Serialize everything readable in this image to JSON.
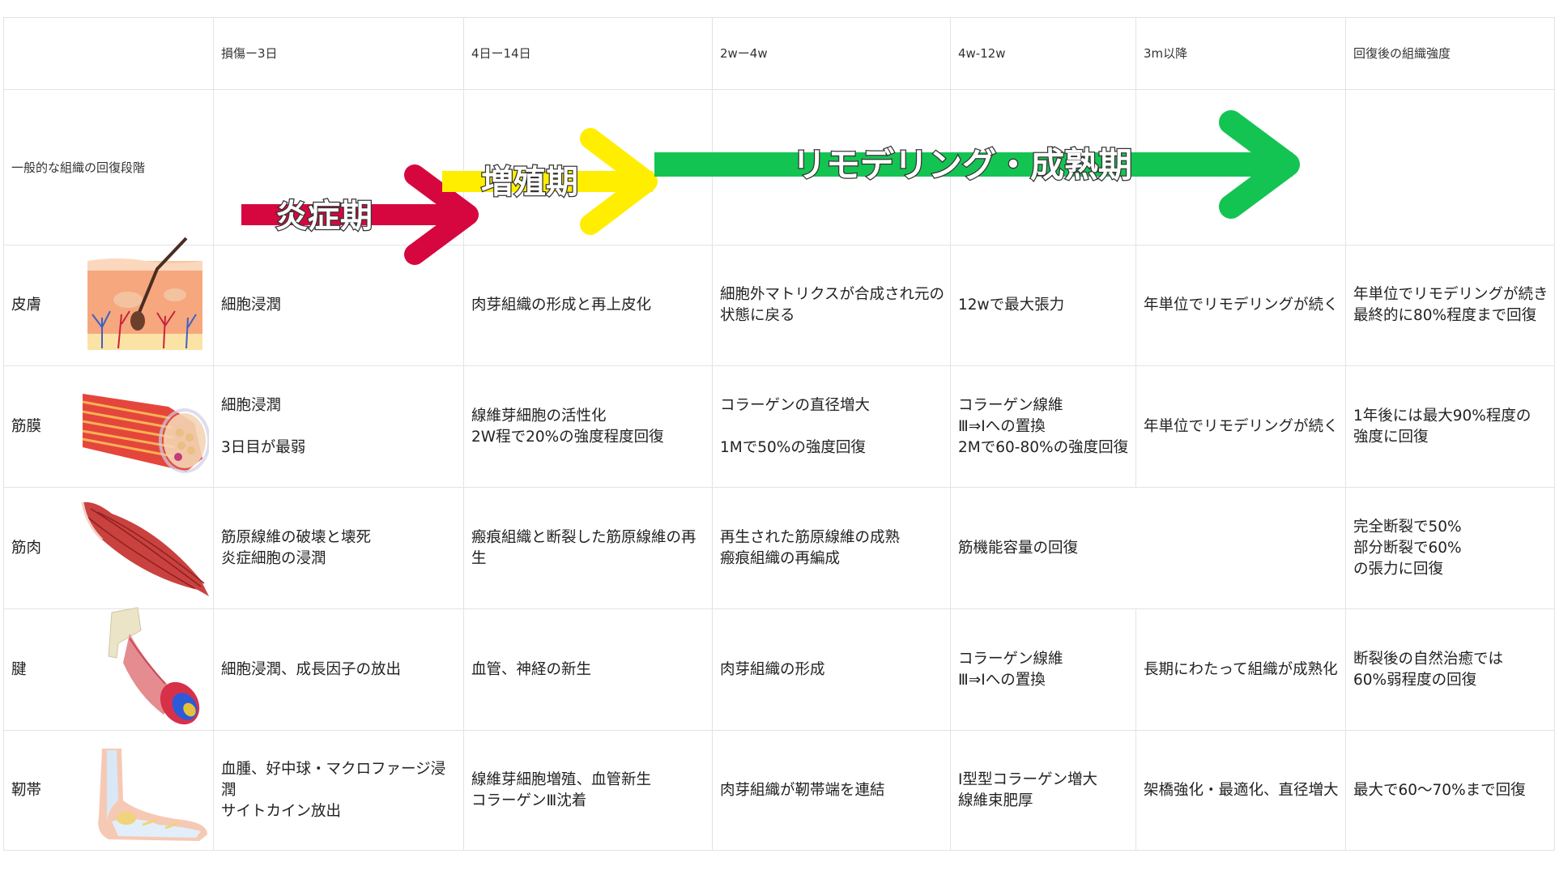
{
  "columns": [
    "",
    "損傷ー3日",
    "4日ー14日",
    "2wー4w",
    "4w-12w",
    "3m以降",
    "回復後の組織強度"
  ],
  "phase_row": {
    "label": "一般的な組織の回復段階",
    "phases": [
      {
        "name": "炎症期",
        "color": "#d6073f"
      },
      {
        "name": "増殖期",
        "color": "#ffee00"
      },
      {
        "name": "リモデリング・成熟期",
        "color": "#13c452"
      }
    ]
  },
  "rows": [
    {
      "label": "皮膚",
      "icon": "skin-icon",
      "cells": [
        "細胞浸潤",
        "肉芽組織の形成と再上皮化",
        "細胞外マトリクスが合成され元の\n状態に戻る",
        "12wで最大張力",
        "年単位でリモデリングが続く",
        "年単位でリモデリングが続き\n最終的に80%程度まで回復"
      ]
    },
    {
      "label": "筋膜",
      "icon": "fascia-icon",
      "cells": [
        "細胞浸潤\n\n3日目が最弱",
        "線維芽細胞の活性化\n2W程で20%の強度程度回復",
        "コラーゲンの直径増大\n\n1Mで50%の強度回復",
        "コラーゲン線維\nⅢ⇒Ⅰへの置換\n2Mで60-80%の強度回復",
        "年単位でリモデリングが続く",
        "1年後には最大90%程度の\n強度に回復"
      ]
    },
    {
      "label": "筋肉",
      "icon": "muscle-icon",
      "cells": [
        "筋原線維の破壊と壊死\n炎症細胞の浸潤",
        "瘢痕組織と断裂した筋原線維の再生",
        "再生された筋原線維の成熟\n瘢痕組織の再編成",
        "筋機能容量の回復",
        "完全断裂で50%\n部分断裂で60%\nの張力に回復"
      ]
    },
    {
      "label": "腱",
      "icon": "tendon-icon",
      "cells": [
        "細胞浸潤、成長因子の放出",
        "血管、神経の新生",
        "肉芽組織の形成",
        "コラーゲン線維\nⅢ⇒Ⅰへの置換",
        "長期にわたって組織が成熟化",
        "断裂後の自然治癒では\n60%弱程度の回復"
      ]
    },
    {
      "label": "靭帯",
      "icon": "ligament-icon",
      "cells": [
        "血腫、好中球・マクロファージ浸潤\nサイトカイン放出",
        "線維芽細胞増殖、血管新生\nコラーゲンⅢ沈着",
        "肉芽組織が靭帯端を連結",
        "Ⅰ型型コラーゲン増大\n線維束肥厚",
        "架橋強化・最適化、直径増大",
        "最大で60〜70%まで回復"
      ]
    }
  ]
}
